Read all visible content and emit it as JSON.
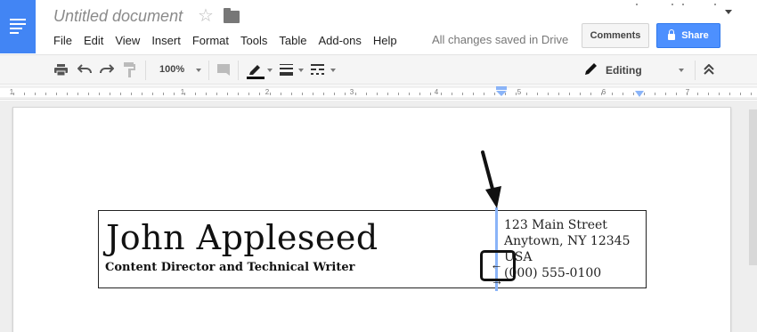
{
  "header": {
    "title": "Untitled document",
    "menus": [
      "File",
      "Edit",
      "View",
      "Insert",
      "Format",
      "Tools",
      "Table",
      "Add-ons",
      "Help"
    ],
    "save_status": "All changes saved in Drive",
    "comments_label": "Comments",
    "share_label": "Share"
  },
  "toolbar": {
    "zoom": "100%",
    "mode": "Editing"
  },
  "ruler": {
    "numbers": [
      "1",
      "1",
      "2",
      "3",
      "4",
      "5",
      "6",
      "7"
    ]
  },
  "document": {
    "name": "John Appleseed",
    "role": "Content Director and Technical Writer",
    "address_lines": [
      "123 Main Street",
      "Anytown, NY 12345",
      "USA",
      "(000) 555-0100"
    ]
  },
  "colors": {
    "brand_blue": "#4285f4",
    "share_blue": "#4d90fe",
    "guide_blue": "#8ab4f8"
  }
}
